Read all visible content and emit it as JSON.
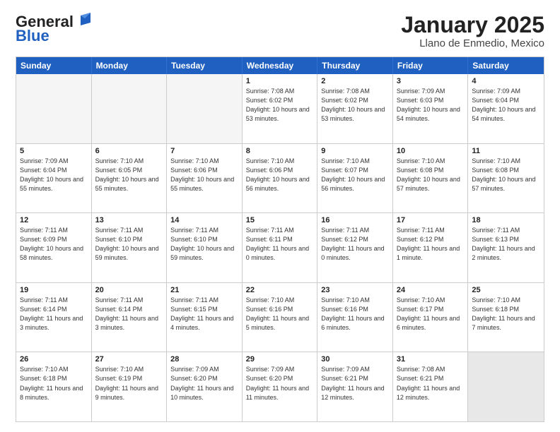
{
  "header": {
    "logo_general": "General",
    "logo_blue": "Blue",
    "month_title": "January 2025",
    "subtitle": "Llano de Enmedio, Mexico"
  },
  "days_of_week": [
    "Sunday",
    "Monday",
    "Tuesday",
    "Wednesday",
    "Thursday",
    "Friday",
    "Saturday"
  ],
  "weeks": [
    [
      {
        "day": "",
        "info": "",
        "empty": true
      },
      {
        "day": "",
        "info": "",
        "empty": true
      },
      {
        "day": "",
        "info": "",
        "empty": true
      },
      {
        "day": "1",
        "info": "Sunrise: 7:08 AM\nSunset: 6:02 PM\nDaylight: 10 hours and 53 minutes.",
        "empty": false
      },
      {
        "day": "2",
        "info": "Sunrise: 7:08 AM\nSunset: 6:02 PM\nDaylight: 10 hours and 53 minutes.",
        "empty": false
      },
      {
        "day": "3",
        "info": "Sunrise: 7:09 AM\nSunset: 6:03 PM\nDaylight: 10 hours and 54 minutes.",
        "empty": false
      },
      {
        "day": "4",
        "info": "Sunrise: 7:09 AM\nSunset: 6:04 PM\nDaylight: 10 hours and 54 minutes.",
        "empty": false
      }
    ],
    [
      {
        "day": "5",
        "info": "Sunrise: 7:09 AM\nSunset: 6:04 PM\nDaylight: 10 hours and 55 minutes.",
        "empty": false
      },
      {
        "day": "6",
        "info": "Sunrise: 7:10 AM\nSunset: 6:05 PM\nDaylight: 10 hours and 55 minutes.",
        "empty": false
      },
      {
        "day": "7",
        "info": "Sunrise: 7:10 AM\nSunset: 6:06 PM\nDaylight: 10 hours and 55 minutes.",
        "empty": false
      },
      {
        "day": "8",
        "info": "Sunrise: 7:10 AM\nSunset: 6:06 PM\nDaylight: 10 hours and 56 minutes.",
        "empty": false
      },
      {
        "day": "9",
        "info": "Sunrise: 7:10 AM\nSunset: 6:07 PM\nDaylight: 10 hours and 56 minutes.",
        "empty": false
      },
      {
        "day": "10",
        "info": "Sunrise: 7:10 AM\nSunset: 6:08 PM\nDaylight: 10 hours and 57 minutes.",
        "empty": false
      },
      {
        "day": "11",
        "info": "Sunrise: 7:10 AM\nSunset: 6:08 PM\nDaylight: 10 hours and 57 minutes.",
        "empty": false
      }
    ],
    [
      {
        "day": "12",
        "info": "Sunrise: 7:11 AM\nSunset: 6:09 PM\nDaylight: 10 hours and 58 minutes.",
        "empty": false
      },
      {
        "day": "13",
        "info": "Sunrise: 7:11 AM\nSunset: 6:10 PM\nDaylight: 10 hours and 59 minutes.",
        "empty": false
      },
      {
        "day": "14",
        "info": "Sunrise: 7:11 AM\nSunset: 6:10 PM\nDaylight: 10 hours and 59 minutes.",
        "empty": false
      },
      {
        "day": "15",
        "info": "Sunrise: 7:11 AM\nSunset: 6:11 PM\nDaylight: 11 hours and 0 minutes.",
        "empty": false
      },
      {
        "day": "16",
        "info": "Sunrise: 7:11 AM\nSunset: 6:12 PM\nDaylight: 11 hours and 0 minutes.",
        "empty": false
      },
      {
        "day": "17",
        "info": "Sunrise: 7:11 AM\nSunset: 6:12 PM\nDaylight: 11 hours and 1 minute.",
        "empty": false
      },
      {
        "day": "18",
        "info": "Sunrise: 7:11 AM\nSunset: 6:13 PM\nDaylight: 11 hours and 2 minutes.",
        "empty": false
      }
    ],
    [
      {
        "day": "19",
        "info": "Sunrise: 7:11 AM\nSunset: 6:14 PM\nDaylight: 11 hours and 3 minutes.",
        "empty": false
      },
      {
        "day": "20",
        "info": "Sunrise: 7:11 AM\nSunset: 6:14 PM\nDaylight: 11 hours and 3 minutes.",
        "empty": false
      },
      {
        "day": "21",
        "info": "Sunrise: 7:11 AM\nSunset: 6:15 PM\nDaylight: 11 hours and 4 minutes.",
        "empty": false
      },
      {
        "day": "22",
        "info": "Sunrise: 7:10 AM\nSunset: 6:16 PM\nDaylight: 11 hours and 5 minutes.",
        "empty": false
      },
      {
        "day": "23",
        "info": "Sunrise: 7:10 AM\nSunset: 6:16 PM\nDaylight: 11 hours and 6 minutes.",
        "empty": false
      },
      {
        "day": "24",
        "info": "Sunrise: 7:10 AM\nSunset: 6:17 PM\nDaylight: 11 hours and 6 minutes.",
        "empty": false
      },
      {
        "day": "25",
        "info": "Sunrise: 7:10 AM\nSunset: 6:18 PM\nDaylight: 11 hours and 7 minutes.",
        "empty": false
      }
    ],
    [
      {
        "day": "26",
        "info": "Sunrise: 7:10 AM\nSunset: 6:18 PM\nDaylight: 11 hours and 8 minutes.",
        "empty": false
      },
      {
        "day": "27",
        "info": "Sunrise: 7:10 AM\nSunset: 6:19 PM\nDaylight: 11 hours and 9 minutes.",
        "empty": false
      },
      {
        "day": "28",
        "info": "Sunrise: 7:09 AM\nSunset: 6:20 PM\nDaylight: 11 hours and 10 minutes.",
        "empty": false
      },
      {
        "day": "29",
        "info": "Sunrise: 7:09 AM\nSunset: 6:20 PM\nDaylight: 11 hours and 11 minutes.",
        "empty": false
      },
      {
        "day": "30",
        "info": "Sunrise: 7:09 AM\nSunset: 6:21 PM\nDaylight: 11 hours and 12 minutes.",
        "empty": false
      },
      {
        "day": "31",
        "info": "Sunrise: 7:08 AM\nSunset: 6:21 PM\nDaylight: 11 hours and 12 minutes.",
        "empty": false
      },
      {
        "day": "",
        "info": "",
        "empty": true,
        "shaded": true
      }
    ]
  ]
}
